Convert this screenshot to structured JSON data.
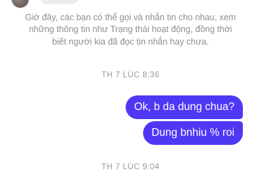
{
  "conversation": {
    "info_message": "Giờ đây, các bạn có thể gọi và nhắn tin cho nhau, xem những thông tin như Trạng thái hoạt động, đồng thời biết người kia đã đọc tin nhắn hay chưa.",
    "timestamp_1": "TH 7 LÚC 8:36",
    "timestamp_2": "TH 7 LÚC 9:04",
    "messages": [
      {
        "text": "Ok, b da dung chua?",
        "sender": "me"
      },
      {
        "text": "Dung bnhiu % roi",
        "sender": "me"
      }
    ]
  },
  "colors": {
    "bubble_background": "#4f38f4",
    "bubble_text": "#ffffff",
    "meta_text": "#8e8e93"
  }
}
